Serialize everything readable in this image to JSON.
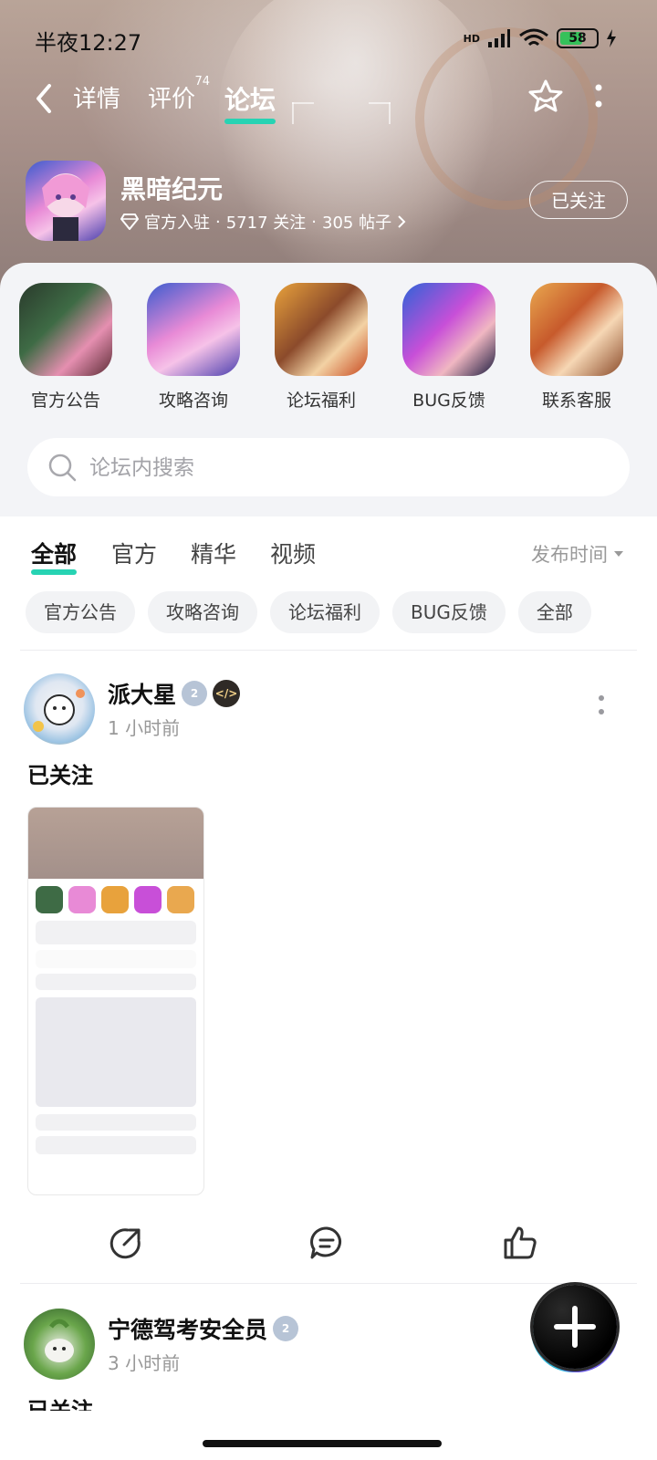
{
  "status_bar": {
    "time": "半夜12:27",
    "battery": "58",
    "network": "HD"
  },
  "nav": {
    "tabs": [
      {
        "label": "详情"
      },
      {
        "label": "评价",
        "badge": "74"
      },
      {
        "label": "论坛",
        "active": true
      }
    ]
  },
  "game": {
    "name": "黑暗纪元",
    "official": "官方入驻",
    "followers": "5717 关注",
    "posts": "305 帖子",
    "separator": "·",
    "follow_label": "已关注"
  },
  "categories": [
    {
      "label": "官方公告",
      "icon": "official-announcement-icon"
    },
    {
      "label": "攻略咨询",
      "icon": "guide-icon"
    },
    {
      "label": "论坛福利",
      "icon": "welfare-icon"
    },
    {
      "label": "BUG反馈",
      "icon": "bug-feedback-icon"
    },
    {
      "label": "联系客服",
      "icon": "customer-service-icon"
    }
  ],
  "search": {
    "placeholder": "论坛内搜索"
  },
  "filter_tabs": [
    {
      "label": "全部",
      "active": true
    },
    {
      "label": "官方"
    },
    {
      "label": "精华"
    },
    {
      "label": "视频"
    }
  ],
  "sort_label": "发布时间",
  "chips": [
    "官方公告",
    "攻略咨询",
    "论坛福利",
    "BUG反馈",
    "全部"
  ],
  "posts": [
    {
      "author": "派大星",
      "time": "1 小时前",
      "text": "已关注",
      "level": "2"
    },
    {
      "author": "宁德驾考安全员",
      "time": "3 小时前",
      "text": "已关注",
      "level": "2"
    }
  ],
  "colors": {
    "accent": "#27d3b3",
    "text": "#111111",
    "muted": "#999999"
  }
}
